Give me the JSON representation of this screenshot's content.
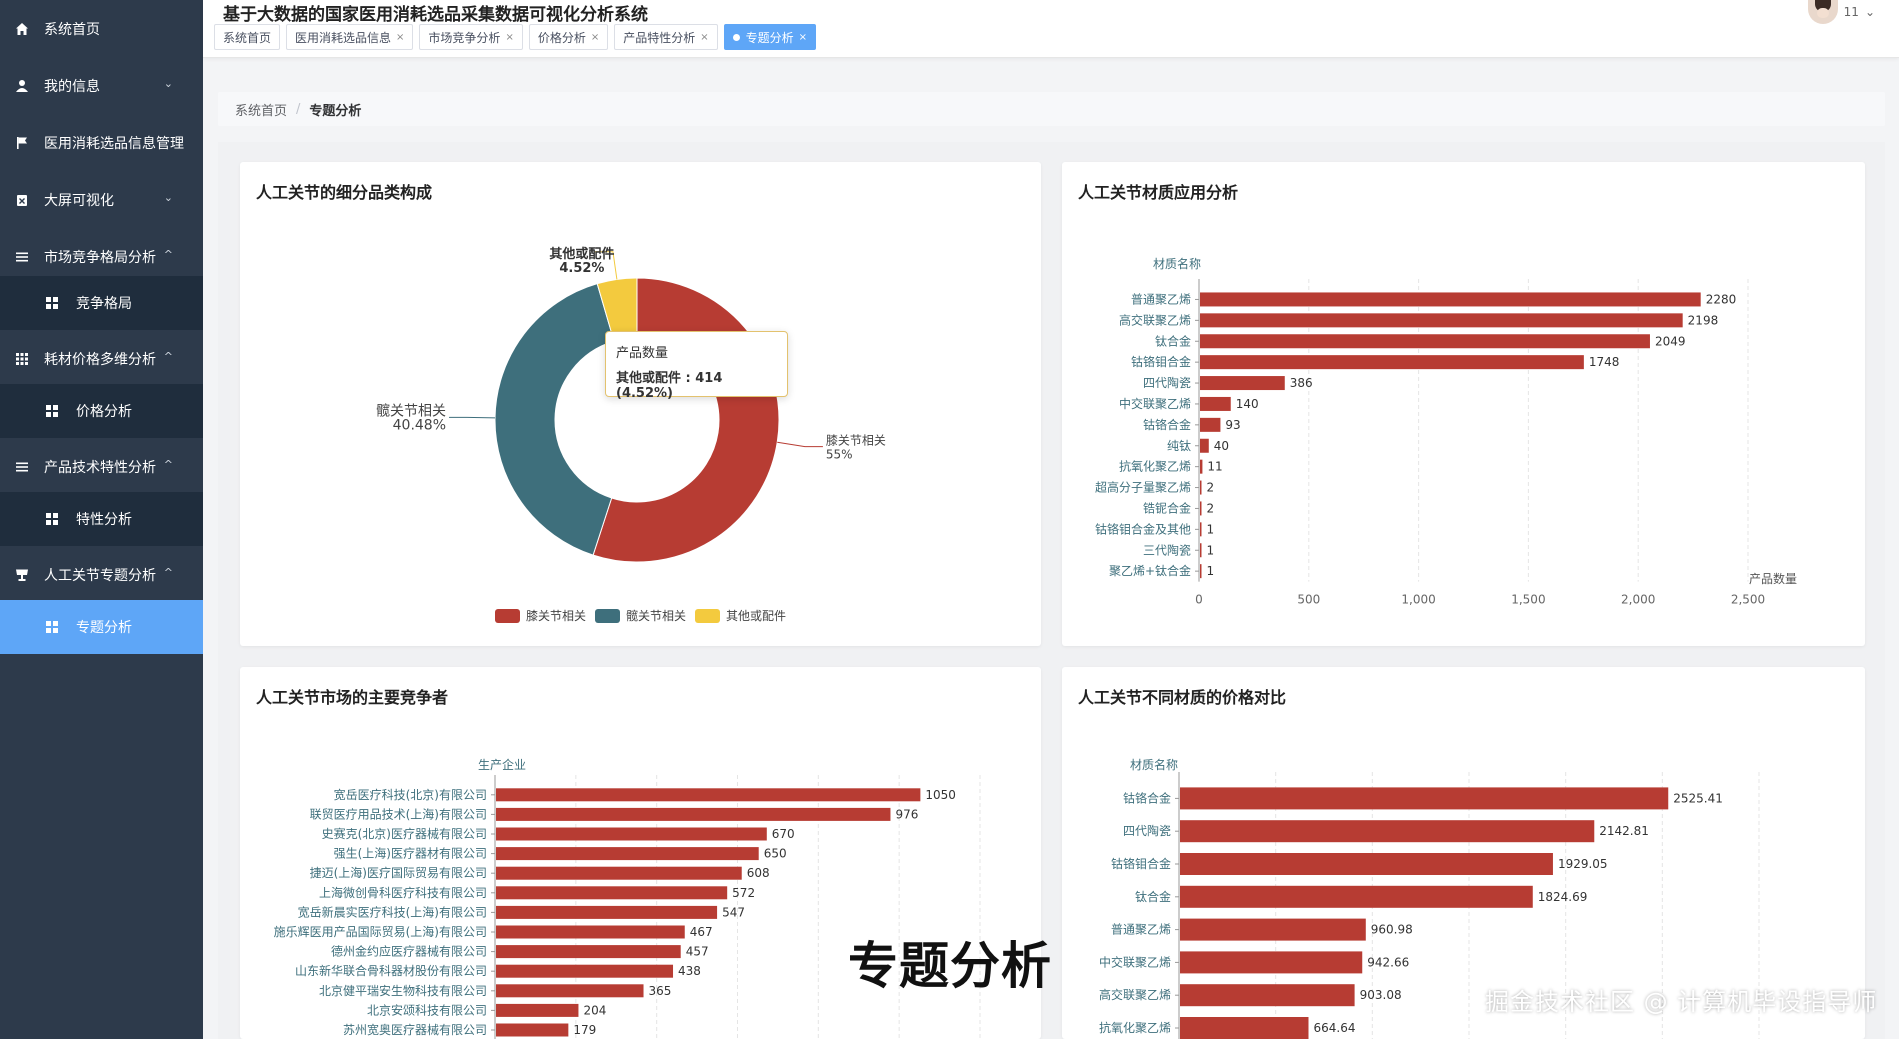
{
  "app": {
    "title": "基于大数据的国家医用消耗选品采集数据可视化分析系统",
    "username": "11"
  },
  "sidebar": {
    "items": [
      {
        "label": "系统首页",
        "icon": "home-icon"
      },
      {
        "label": "我的信息",
        "icon": "user-icon"
      },
      {
        "label": "医用消耗选品信息管理",
        "icon": "flag-icon"
      },
      {
        "label": "大屏可视化",
        "icon": "clipboard-icon"
      },
      {
        "label": "市场竞争格局分析",
        "icon": "list-icon"
      },
      {
        "label": "竞争格局",
        "icon": "grid-icon"
      },
      {
        "label": "耗材价格多维分析",
        "icon": "grid9-icon"
      },
      {
        "label": "价格分析",
        "icon": "grid-icon"
      },
      {
        "label": "产品技术特性分析",
        "icon": "list-icon"
      },
      {
        "label": "特性分析",
        "icon": "grid-icon"
      },
      {
        "label": "人工关节专题分析",
        "icon": "cup-icon"
      },
      {
        "label": "专题分析",
        "icon": "grid-icon"
      }
    ],
    "active_color": "#5ea6f7",
    "bg_color": "#2d3a4b"
  },
  "tabs": [
    {
      "label": "系统首页",
      "closable": false
    },
    {
      "label": "医用消耗选品信息",
      "closable": true
    },
    {
      "label": "市场竞争分析",
      "closable": true
    },
    {
      "label": "价格分析",
      "closable": true
    },
    {
      "label": "产品特性分析",
      "closable": true
    },
    {
      "label": "专题分析",
      "closable": true,
      "active": true
    }
  ],
  "close_glyph": "×",
  "breadcrumb": {
    "home": "系统首页",
    "separator": "/",
    "current": "专题分析"
  },
  "cards": {
    "pie_title": "人工关节的细分品类构成",
    "material_title": "人工关节材质应用分析",
    "competitor_title": "人工关节市场的主要竞争者",
    "price_title": "人工关节不同材质的价格对比"
  },
  "tooltip": {
    "series": "产品数量",
    "text": "其他或配件 : 414 (4.52%)"
  },
  "caption": "专题分析",
  "watermark": "掘金技术社区 @ 计算机毕设指导师",
  "chart_data": [
    {
      "type": "pie",
      "title": "人工关节的细分品类构成",
      "series_name": "产品数量",
      "slices": [
        {
          "name": "膝关节相关",
          "percent": 55,
          "label": "膝关节相关\n55%",
          "color": "#b73c33"
        },
        {
          "name": "髋关节相关",
          "percent": 40.48,
          "label": "髋关节相关\n40.48%",
          "color": "#3e6f7c"
        },
        {
          "name": "其他或配件",
          "percent": 4.52,
          "value": 414,
          "label": "其他或配件\n4.52%",
          "color": "#f3ca3e"
        }
      ],
      "legend": [
        "膝关节相关",
        "髋关节相关",
        "其他或配件"
      ],
      "legend_position": "bottom"
    },
    {
      "type": "bar",
      "orientation": "horizontal",
      "title": "人工关节材质应用分析",
      "ylabel": "材质名称",
      "xlabel": "产品数量",
      "categories": [
        "普通聚乙烯",
        "高交联聚乙烯",
        "钛合金",
        "钴铬钼合金",
        "四代陶瓷",
        "中交联聚乙烯",
        "钴铬合金",
        "纯钛",
        "抗氧化聚乙烯",
        "超高分子量聚乙烯",
        "锆铌合金",
        "钴铬钼合金及其他",
        "三代陶瓷",
        "聚乙烯+钛合金"
      ],
      "values": [
        2280,
        2198,
        2049,
        1748,
        386,
        140,
        93,
        40,
        11,
        2,
        2,
        1,
        1,
        1
      ],
      "xlim": [
        0,
        2500
      ],
      "xticks": [
        "0",
        "500",
        "1,000",
        "1,500",
        "2,000",
        "2,500"
      ],
      "color": "#b73c33"
    },
    {
      "type": "bar",
      "orientation": "horizontal",
      "title": "人工关节市场的主要竞争者",
      "ylabel": "生产企业",
      "categories": [
        "宽岳医疗科技(北京)有限公司",
        "联贸医疗用品技术(上海)有限公司",
        "史赛克(北京)医疗器械有限公司",
        "强生(上海)医疗器材有限公司",
        "捷迈(上海)医疗国际贸易有限公司",
        "上海微创骨科医疗科技有限公司",
        "宽岳新晨实医疗科技(上海)有限公司",
        "施乐辉医用产品国际贸易(上海)有限公司",
        "德州金约应医疗器械有限公司",
        "山东新华联合骨科器材股份有限公司",
        "北京健平瑞安生物科技有限公司",
        "北京安颂科技有限公司",
        "苏州宽奥医疗器械有限公司"
      ],
      "values": [
        1050,
        976,
        670,
        650,
        608,
        572,
        547,
        467,
        457,
        438,
        365,
        204,
        179
      ],
      "xlim": [
        0,
        1200
      ],
      "color": "#b73c33"
    },
    {
      "type": "bar",
      "orientation": "horizontal",
      "title": "人工关节不同材质的价格对比",
      "ylabel": "材质名称",
      "categories": [
        "钴铬合金",
        "四代陶瓷",
        "钴铬钼合金",
        "钛合金",
        "普通聚乙烯",
        "中交联聚乙烯",
        "高交联聚乙烯",
        "抗氧化聚乙烯"
      ],
      "values": [
        2525.41,
        2142.81,
        1929.05,
        1824.69,
        960.98,
        942.66,
        903.08,
        664.64
      ],
      "xlim": [
        0,
        3000
      ],
      "color": "#b73c33"
    }
  ]
}
